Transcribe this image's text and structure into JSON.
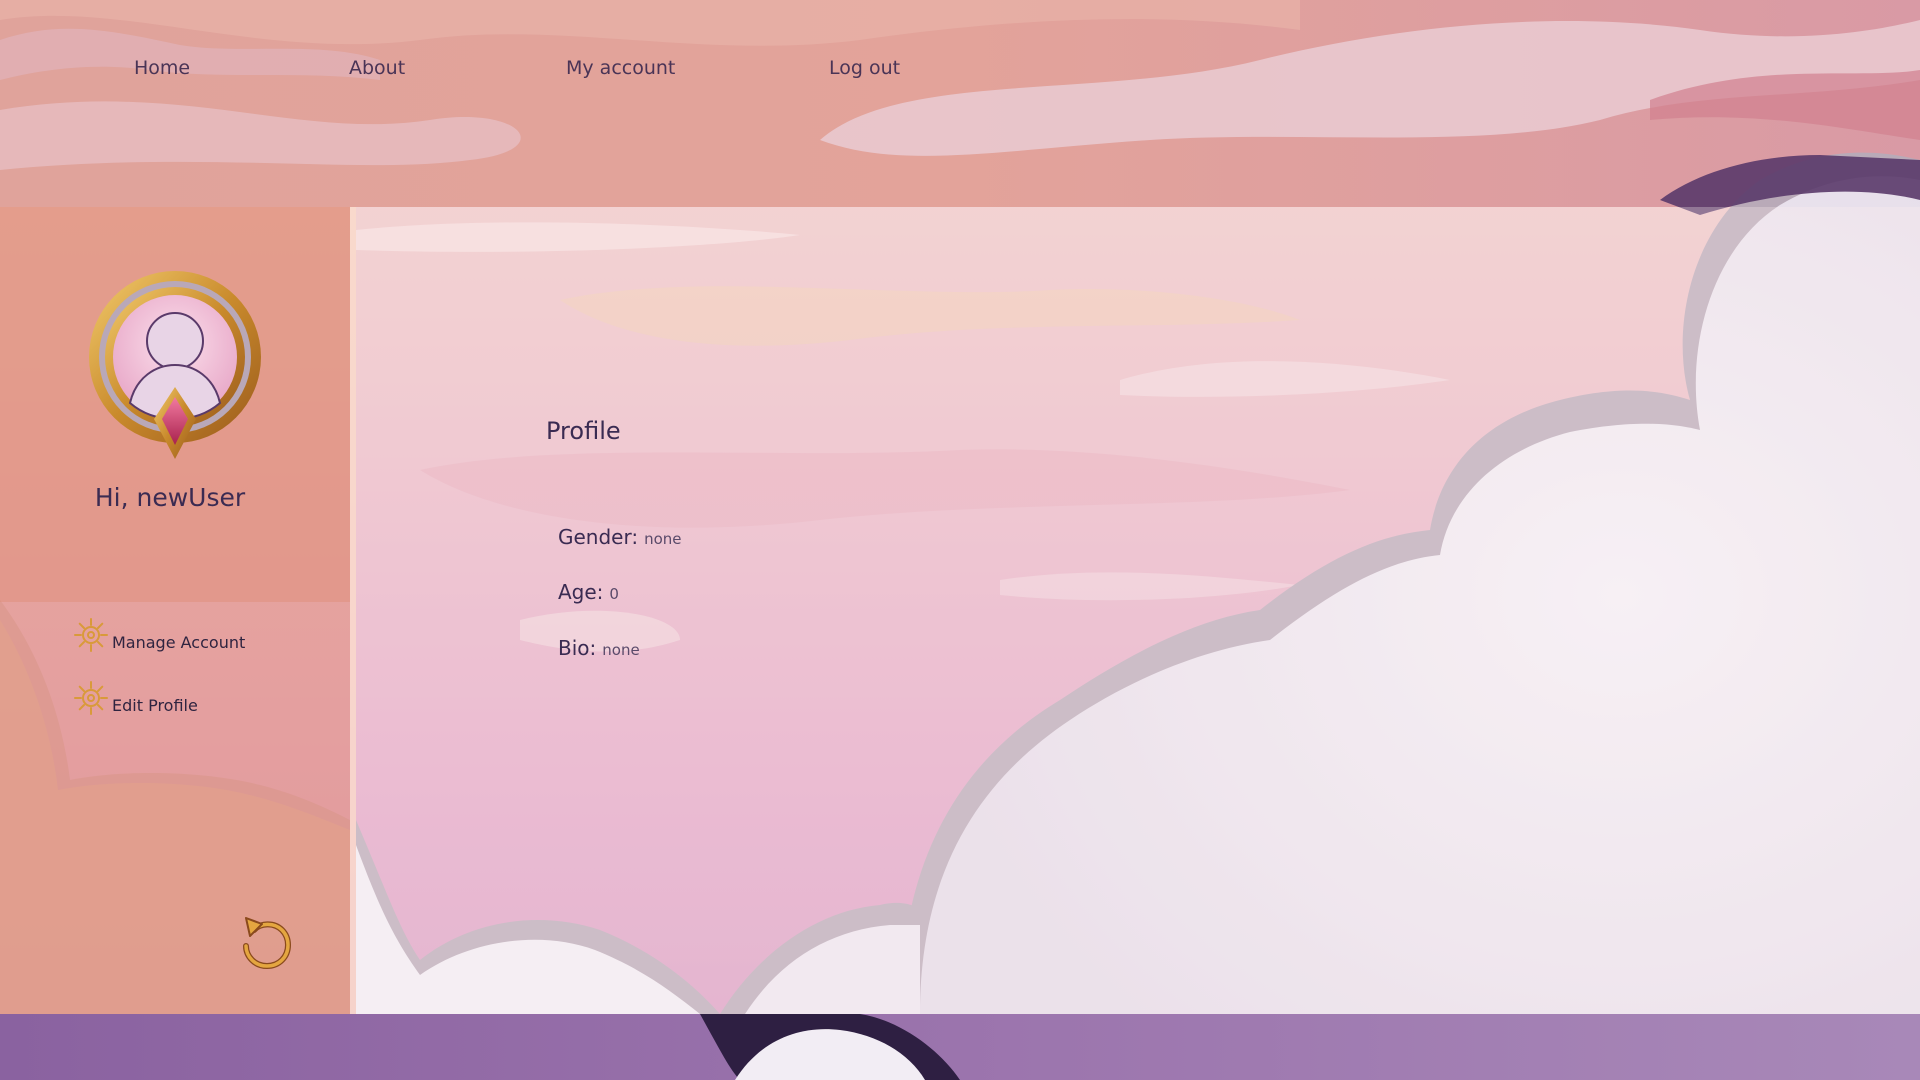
{
  "nav": {
    "items": [
      {
        "label": "Home"
      },
      {
        "label": "About"
      },
      {
        "label": "My account"
      },
      {
        "label": "Log out"
      }
    ]
  },
  "sidebar": {
    "greeting": "Hi, newUser",
    "items": [
      {
        "label": "Manage Account",
        "icon": "gear-icon"
      },
      {
        "label": "Edit Profile",
        "icon": "gear-icon"
      }
    ],
    "back_icon": "undo-arrow-icon",
    "avatar_icon": "user-avatar-icon"
  },
  "profile": {
    "title": "Profile",
    "fields": [
      {
        "label": "Gender:",
        "value": "none"
      },
      {
        "label": "Age:",
        "value": "0"
      },
      {
        "label": "Bio:",
        "value": "none"
      }
    ]
  },
  "colors": {
    "accent_gold": "#d9a23a",
    "text_dark": "#3a2b52",
    "sidebar_peach": "#e4967e",
    "sky_pink": "#e6a8b8",
    "cloud_purple": "#5a3a6a"
  }
}
